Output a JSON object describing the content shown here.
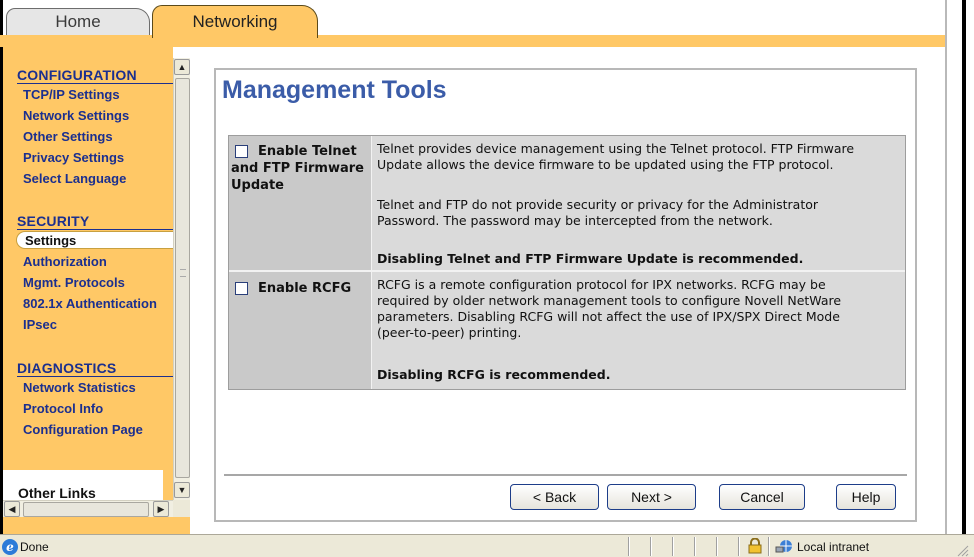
{
  "tabs": [
    {
      "label": "Home",
      "active": false
    },
    {
      "label": "Networking",
      "active": true
    }
  ],
  "sidebar": {
    "sections": [
      {
        "heading": "CONFIGURATION",
        "items": [
          "TCP/IP Settings",
          "Network Settings",
          "Other Settings",
          "Privacy Settings",
          "Select Language"
        ]
      },
      {
        "heading": "SECURITY",
        "items": [
          "Settings",
          "Authorization",
          "Mgmt. Protocols",
          "802.1x Authentication",
          "IPsec"
        ]
      },
      {
        "heading": "DIAGNOSTICS",
        "items": [
          "Network Statistics",
          "Protocol Info",
          "Configuration Page"
        ]
      }
    ],
    "selected_item": "Settings",
    "other_links": "Other Links"
  },
  "main": {
    "title": "Management Tools",
    "options": [
      {
        "label_lines": [
          "Enable Telnet",
          "and FTP Firmware",
          "Update"
        ],
        "checked": false,
        "description": [
          "Telnet provides device management using the Telnet protocol. FTP Firmware",
          "Update allows the device firmware to be updated using the FTP protocol.",
          "Telnet and FTP do not provide security or privacy for the Administrator",
          "Password. The password may be intercepted from the network."
        ],
        "recommendation": "Disabling Telnet and FTP Firmware Update is recommended."
      },
      {
        "label_lines": [
          "Enable RCFG"
        ],
        "checked": false,
        "description": [
          "RCFG is a remote configuration protocol for IPX networks. RCFG may be",
          "required by older network management tools to configure Novell NetWare",
          "parameters.   Disabling RCFG will not affect the use of IPX/SPX Direct Mode",
          "(peer-to-peer) printing."
        ],
        "recommendation": "Disabling RCFG is recommended."
      }
    ],
    "buttons": {
      "back": "< Back",
      "next": "Next >",
      "cancel": "Cancel",
      "help": "Help"
    }
  },
  "statusbar": {
    "status": "Done",
    "zone": "Local intranet"
  },
  "colors": {
    "accent_orange": "#ffc866",
    "title_blue": "#3b5ca8",
    "nav_blue": "#1b2f8f"
  }
}
